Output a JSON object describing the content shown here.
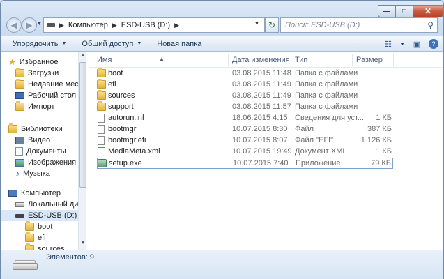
{
  "window": {
    "controls": {
      "minimize": "—",
      "maximize": "□",
      "close": "✕"
    }
  },
  "nav": {
    "back_icon": "back-arrow-icon",
    "forward_icon": "forward-arrow-icon",
    "breadcrumb": [
      "Компьютер",
      "ESD-USB (D:)"
    ],
    "refresh_icon": "refresh-icon",
    "search_placeholder": "Поиск: ESD-USB (D:)"
  },
  "toolbar": {
    "organize": "Упорядочить",
    "share": "Общий доступ",
    "new_folder": "Новая папка"
  },
  "sidebar": {
    "favorites": {
      "label": "Избранное",
      "items": [
        "Загрузки",
        "Недавние места",
        "Рабочий стол",
        "Импорт"
      ]
    },
    "libraries": {
      "label": "Библиотеки",
      "items": [
        "Видео",
        "Документы",
        "Изображения",
        "Музыка"
      ]
    },
    "computer": {
      "label": "Компьютер",
      "items": [
        "Локальный диск",
        "ESD-USB (D:)"
      ]
    },
    "usb_children": [
      "boot",
      "efi",
      "sources"
    ]
  },
  "columns": {
    "name": "Имя",
    "date": "Дата изменения",
    "type": "Тип",
    "size": "Размер"
  },
  "files": [
    {
      "name": "boot",
      "date": "03.08.2015 11:48",
      "type": "Папка с файлами",
      "size": "",
      "icon": "folder"
    },
    {
      "name": "efi",
      "date": "03.08.2015 11:49",
      "type": "Папка с файлами",
      "size": "",
      "icon": "folder"
    },
    {
      "name": "sources",
      "date": "03.08.2015 11:49",
      "type": "Папка с файлами",
      "size": "",
      "icon": "folder"
    },
    {
      "name": "support",
      "date": "03.08.2015 11:57",
      "type": "Папка с файлами",
      "size": "",
      "icon": "folder"
    },
    {
      "name": "autorun.inf",
      "date": "18.06.2015 4:15",
      "type": "Сведения для уст...",
      "size": "1 КБ",
      "icon": "inf"
    },
    {
      "name": "bootmgr",
      "date": "10.07.2015 8:30",
      "type": "Файл",
      "size": "387 КБ",
      "icon": "file"
    },
    {
      "name": "bootmgr.efi",
      "date": "10.07.2015 8:07",
      "type": "Файл \"EFI\"",
      "size": "1 126 КБ",
      "icon": "file"
    },
    {
      "name": "MediaMeta.xml",
      "date": "10.07.2015 19:49",
      "type": "Документ XML",
      "size": "1 КБ",
      "icon": "xml"
    },
    {
      "name": "setup.exe",
      "date": "10.07.2015 7:40",
      "type": "Приложение",
      "size": "79 КБ",
      "icon": "exe"
    }
  ],
  "status": {
    "count": "Элементов: 9"
  }
}
